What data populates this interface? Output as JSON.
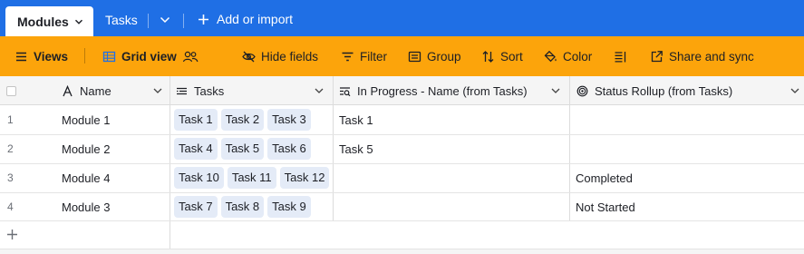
{
  "tabs": {
    "active_label": "Modules",
    "second_label": "Tasks",
    "add_import_label": "Add or import"
  },
  "toolbar": {
    "views_label": "Views",
    "grid_view_label": "Grid view",
    "hide_fields_label": "Hide fields",
    "filter_label": "Filter",
    "group_label": "Group",
    "sort_label": "Sort",
    "color_label": "Color",
    "share_label": "Share and sync"
  },
  "columns": {
    "name": "Name",
    "tasks": "Tasks",
    "in_progress": "In Progress - Name (from Tasks)",
    "status_rollup": "Status Rollup (from Tasks)"
  },
  "rows": [
    {
      "num": "1",
      "name": "Module 1",
      "tasks": [
        "Task 1",
        "Task 2",
        "Task 3"
      ],
      "in_progress": "Task 1",
      "status": ""
    },
    {
      "num": "2",
      "name": "Module 2",
      "tasks": [
        "Task 4",
        "Task 5",
        "Task 6"
      ],
      "in_progress": "Task 5",
      "status": ""
    },
    {
      "num": "3",
      "name": "Module 4",
      "tasks": [
        "Task 10",
        "Task 11",
        "Task 12"
      ],
      "in_progress": "",
      "status": "Completed"
    },
    {
      "num": "4",
      "name": "Module 3",
      "tasks": [
        "Task 7",
        "Task 8",
        "Task 9"
      ],
      "in_progress": "",
      "status": "Not Started"
    }
  ],
  "colors": {
    "tabbar": "#1f6fe5",
    "toolbar": "#fca40b",
    "chip": "#e4ebf7"
  }
}
